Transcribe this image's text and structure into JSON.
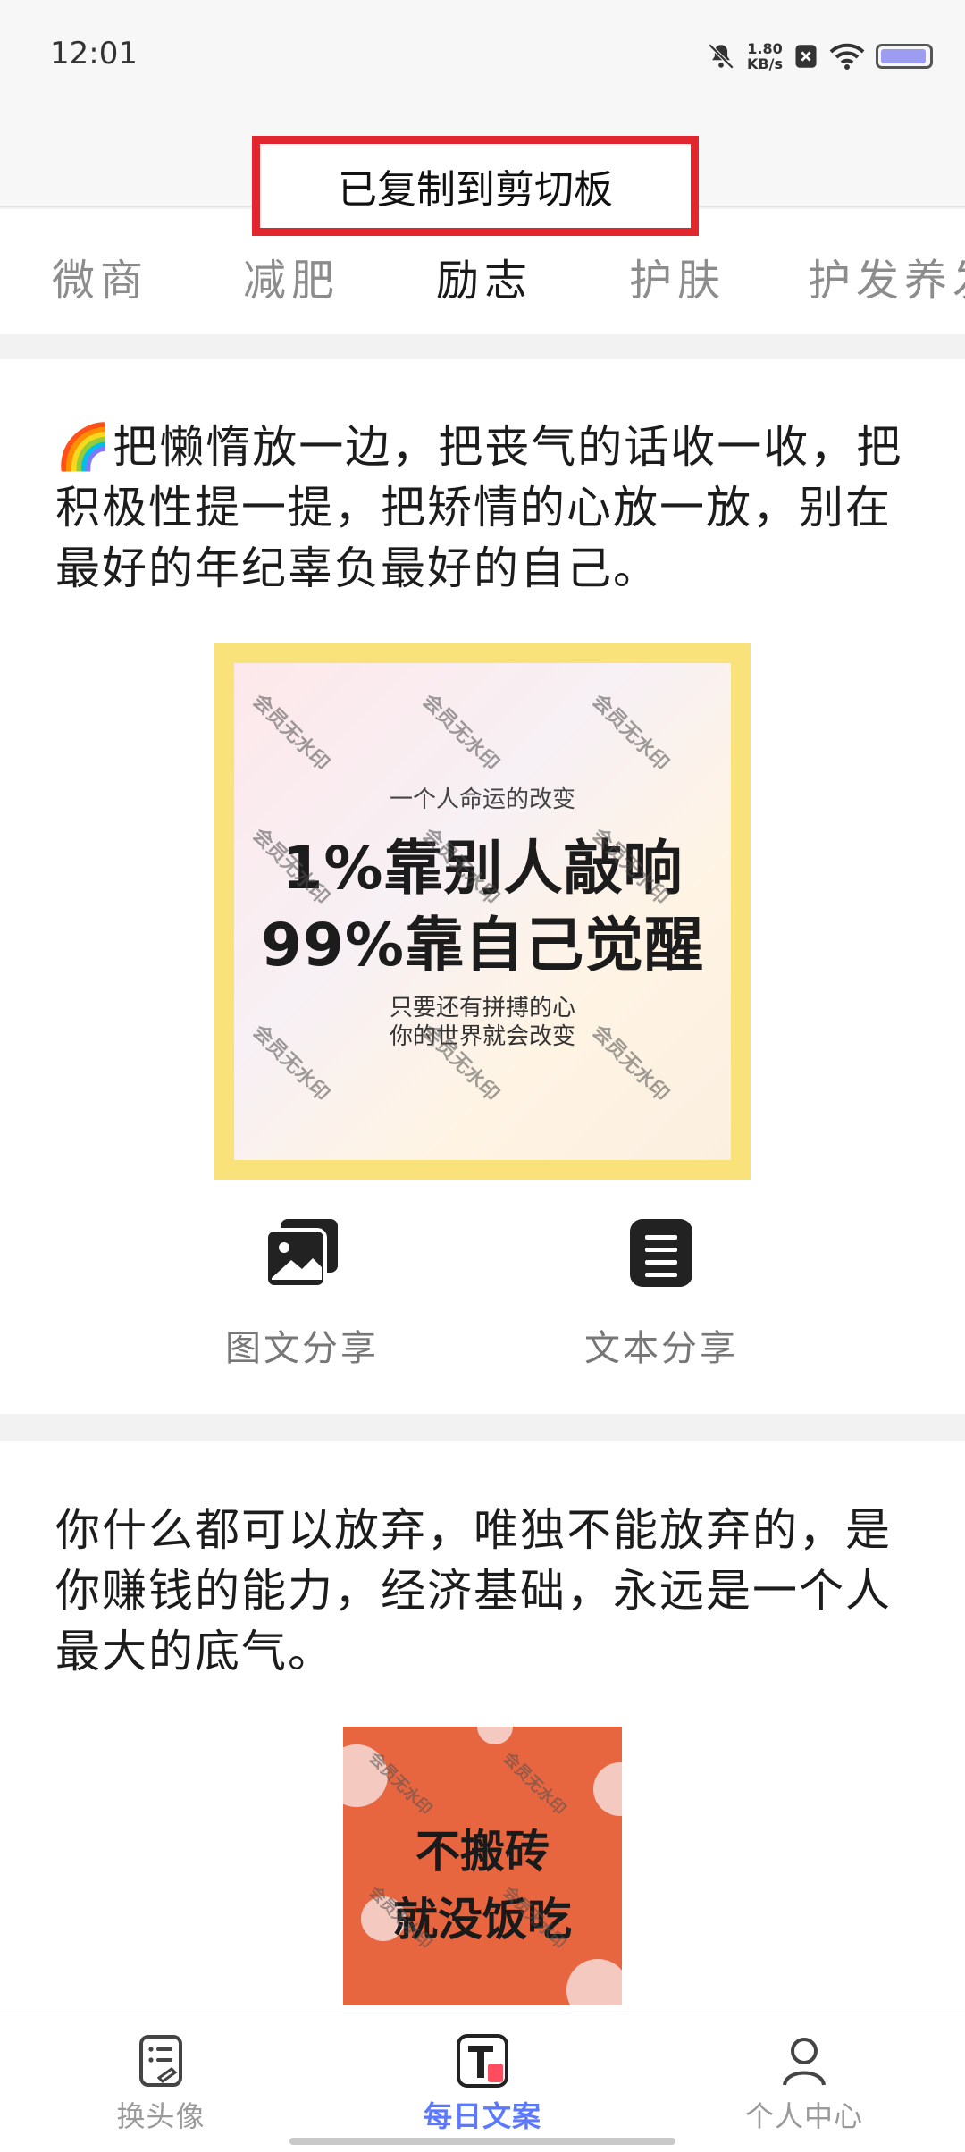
{
  "status_bar": {
    "time": "12:01",
    "net_speed_value": "1.80",
    "net_speed_unit": "KB/s",
    "battery_color": "#9c9cf0"
  },
  "toast": {
    "text": "已复制到剪切板"
  },
  "tabs": [
    {
      "label": "微商",
      "active": false
    },
    {
      "label": "减肥",
      "active": false
    },
    {
      "label": "励志",
      "active": true
    },
    {
      "label": "护肤",
      "active": false
    },
    {
      "label": "护发养发",
      "active": false
    }
  ],
  "posts": [
    {
      "emoji": "🌈",
      "text": "把懒惰放一边，把丧气的话收一收，把积极性提一提，把矫情的心放一放，别在最好的年纪辜负最好的自己。",
      "image": {
        "subtitle": "一个人命运的改变",
        "line1": "1%靠别人敲响",
        "line2": "99%靠自己觉醒",
        "foot1": "只要还有拼搏的心",
        "foot2": "你的世界就会改变",
        "watermark": "会员无水印"
      },
      "share": {
        "image_share_label": "图文分享",
        "text_share_label": "文本分享"
      }
    },
    {
      "text": "你什么都可以放弃，唯独不能放弃的，是你赚钱的能力，经济基础，永远是一个人最大的底气。",
      "image": {
        "line1": "不搬砖",
        "line2": "就没饭吃",
        "watermark": "会员无水印"
      }
    }
  ],
  "bottom_nav": [
    {
      "label": "换头像",
      "icon": "avatar-list-icon",
      "active": false
    },
    {
      "label": "每日文案",
      "icon": "daily-text-icon",
      "active": true
    },
    {
      "label": "个人中心",
      "icon": "person-icon",
      "active": false
    }
  ],
  "colors": {
    "accent": "#5b78ff",
    "toast_border": "#e3262e",
    "poster_frame": "#f9e27a",
    "poster2_bg": "#e8663f"
  }
}
